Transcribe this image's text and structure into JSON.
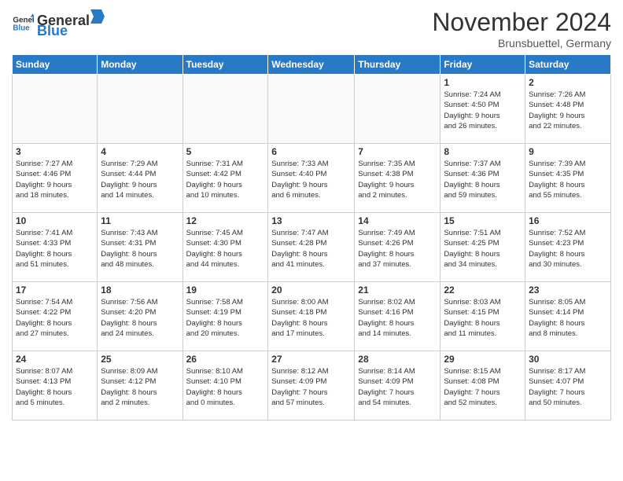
{
  "header": {
    "logo_general": "General",
    "logo_blue": "Blue",
    "month_title": "November 2024",
    "subtitle": "Brunsbuettel, Germany"
  },
  "days_of_week": [
    "Sunday",
    "Monday",
    "Tuesday",
    "Wednesday",
    "Thursday",
    "Friday",
    "Saturday"
  ],
  "weeks": [
    [
      {
        "day": "",
        "info": "",
        "empty": true
      },
      {
        "day": "",
        "info": "",
        "empty": true
      },
      {
        "day": "",
        "info": "",
        "empty": true
      },
      {
        "day": "",
        "info": "",
        "empty": true
      },
      {
        "day": "",
        "info": "",
        "empty": true
      },
      {
        "day": "1",
        "info": "Sunrise: 7:24 AM\nSunset: 4:50 PM\nDaylight: 9 hours\nand 26 minutes."
      },
      {
        "day": "2",
        "info": "Sunrise: 7:26 AM\nSunset: 4:48 PM\nDaylight: 9 hours\nand 22 minutes."
      }
    ],
    [
      {
        "day": "3",
        "info": "Sunrise: 7:27 AM\nSunset: 4:46 PM\nDaylight: 9 hours\nand 18 minutes."
      },
      {
        "day": "4",
        "info": "Sunrise: 7:29 AM\nSunset: 4:44 PM\nDaylight: 9 hours\nand 14 minutes."
      },
      {
        "day": "5",
        "info": "Sunrise: 7:31 AM\nSunset: 4:42 PM\nDaylight: 9 hours\nand 10 minutes."
      },
      {
        "day": "6",
        "info": "Sunrise: 7:33 AM\nSunset: 4:40 PM\nDaylight: 9 hours\nand 6 minutes."
      },
      {
        "day": "7",
        "info": "Sunrise: 7:35 AM\nSunset: 4:38 PM\nDaylight: 9 hours\nand 2 minutes."
      },
      {
        "day": "8",
        "info": "Sunrise: 7:37 AM\nSunset: 4:36 PM\nDaylight: 8 hours\nand 59 minutes."
      },
      {
        "day": "9",
        "info": "Sunrise: 7:39 AM\nSunset: 4:35 PM\nDaylight: 8 hours\nand 55 minutes."
      }
    ],
    [
      {
        "day": "10",
        "info": "Sunrise: 7:41 AM\nSunset: 4:33 PM\nDaylight: 8 hours\nand 51 minutes."
      },
      {
        "day": "11",
        "info": "Sunrise: 7:43 AM\nSunset: 4:31 PM\nDaylight: 8 hours\nand 48 minutes."
      },
      {
        "day": "12",
        "info": "Sunrise: 7:45 AM\nSunset: 4:30 PM\nDaylight: 8 hours\nand 44 minutes."
      },
      {
        "day": "13",
        "info": "Sunrise: 7:47 AM\nSunset: 4:28 PM\nDaylight: 8 hours\nand 41 minutes."
      },
      {
        "day": "14",
        "info": "Sunrise: 7:49 AM\nSunset: 4:26 PM\nDaylight: 8 hours\nand 37 minutes."
      },
      {
        "day": "15",
        "info": "Sunrise: 7:51 AM\nSunset: 4:25 PM\nDaylight: 8 hours\nand 34 minutes."
      },
      {
        "day": "16",
        "info": "Sunrise: 7:52 AM\nSunset: 4:23 PM\nDaylight: 8 hours\nand 30 minutes."
      }
    ],
    [
      {
        "day": "17",
        "info": "Sunrise: 7:54 AM\nSunset: 4:22 PM\nDaylight: 8 hours\nand 27 minutes."
      },
      {
        "day": "18",
        "info": "Sunrise: 7:56 AM\nSunset: 4:20 PM\nDaylight: 8 hours\nand 24 minutes."
      },
      {
        "day": "19",
        "info": "Sunrise: 7:58 AM\nSunset: 4:19 PM\nDaylight: 8 hours\nand 20 minutes."
      },
      {
        "day": "20",
        "info": "Sunrise: 8:00 AM\nSunset: 4:18 PM\nDaylight: 8 hours\nand 17 minutes."
      },
      {
        "day": "21",
        "info": "Sunrise: 8:02 AM\nSunset: 4:16 PM\nDaylight: 8 hours\nand 14 minutes."
      },
      {
        "day": "22",
        "info": "Sunrise: 8:03 AM\nSunset: 4:15 PM\nDaylight: 8 hours\nand 11 minutes."
      },
      {
        "day": "23",
        "info": "Sunrise: 8:05 AM\nSunset: 4:14 PM\nDaylight: 8 hours\nand 8 minutes."
      }
    ],
    [
      {
        "day": "24",
        "info": "Sunrise: 8:07 AM\nSunset: 4:13 PM\nDaylight: 8 hours\nand 5 minutes."
      },
      {
        "day": "25",
        "info": "Sunrise: 8:09 AM\nSunset: 4:12 PM\nDaylight: 8 hours\nand 2 minutes."
      },
      {
        "day": "26",
        "info": "Sunrise: 8:10 AM\nSunset: 4:10 PM\nDaylight: 8 hours\nand 0 minutes."
      },
      {
        "day": "27",
        "info": "Sunrise: 8:12 AM\nSunset: 4:09 PM\nDaylight: 7 hours\nand 57 minutes."
      },
      {
        "day": "28",
        "info": "Sunrise: 8:14 AM\nSunset: 4:09 PM\nDaylight: 7 hours\nand 54 minutes."
      },
      {
        "day": "29",
        "info": "Sunrise: 8:15 AM\nSunset: 4:08 PM\nDaylight: 7 hours\nand 52 minutes."
      },
      {
        "day": "30",
        "info": "Sunrise: 8:17 AM\nSunset: 4:07 PM\nDaylight: 7 hours\nand 50 minutes."
      }
    ]
  ]
}
